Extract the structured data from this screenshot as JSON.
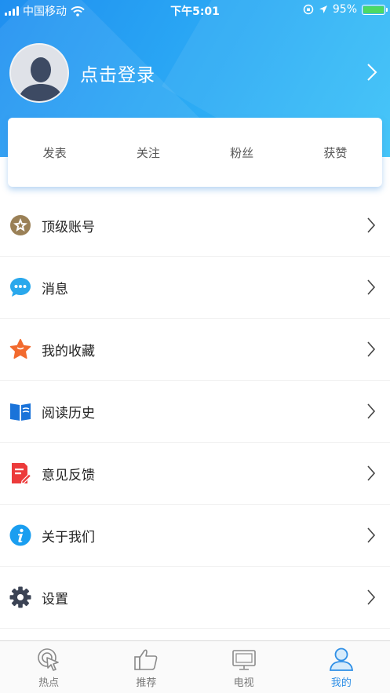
{
  "status_bar": {
    "carrier": "中国移动",
    "time": "下午5:01",
    "battery_percent": "95%",
    "battery_level": 0.95
  },
  "profile": {
    "login_label": "点击登录"
  },
  "stats": [
    {
      "label": "发表"
    },
    {
      "label": "关注"
    },
    {
      "label": "粉丝"
    },
    {
      "label": "获赞"
    }
  ],
  "menu": [
    {
      "label": "顶级账号",
      "icon": "star-medal-icon",
      "color": "#9a8056"
    },
    {
      "label": "消息",
      "icon": "chat-bubble-icon",
      "color": "#2aa8ec"
    },
    {
      "label": "我的收藏",
      "icon": "star-icon",
      "color": "#f26a2e"
    },
    {
      "label": "阅读历史",
      "icon": "book-icon",
      "color": "#1a73d9"
    },
    {
      "label": "意见反馈",
      "icon": "feedback-icon",
      "color": "#ec3b3b"
    },
    {
      "label": "关于我们",
      "icon": "info-icon",
      "color": "#1a9ef0"
    },
    {
      "label": "设置",
      "icon": "gear-icon",
      "color": "#3b4354"
    }
  ],
  "tabbar": [
    {
      "label": "热点",
      "icon": "hotspot-icon",
      "active": false
    },
    {
      "label": "推荐",
      "icon": "thumbs-up-icon",
      "active": false
    },
    {
      "label": "电视",
      "icon": "tv-icon",
      "active": false
    },
    {
      "label": "我的",
      "icon": "user-icon",
      "active": true
    }
  ],
  "colors": {
    "header_start": "#1f8ff0",
    "header_end": "#39c2f8",
    "tab_active": "#2f8fe6",
    "tab_inactive": "#777777"
  }
}
